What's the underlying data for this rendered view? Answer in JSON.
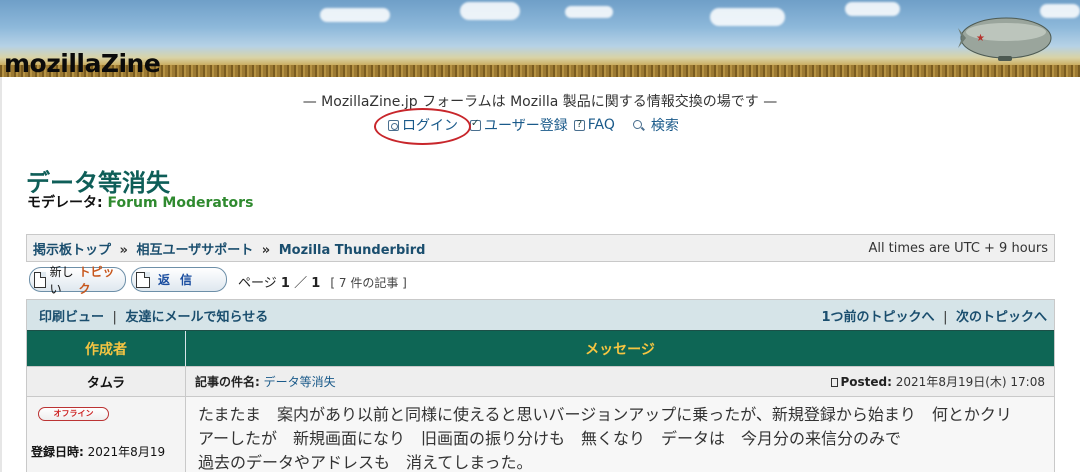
{
  "banner": {
    "logo": "mozillaZine",
    "icons": {
      "zeppelin": "zeppelin-icon"
    }
  },
  "site": {
    "description": "— MozillaZine.jp フォーラムは Mozilla 製品に関する情報交換の場です —",
    "nav": {
      "login": "ログイン",
      "register": "ユーザー登録",
      "faq": "FAQ",
      "search": "検索"
    },
    "highlight_color": "#c8262b"
  },
  "forum": {
    "title": "データ等消失",
    "moderators_label": "モデレータ:",
    "moderators_value": "Forum Moderators"
  },
  "breadcrumb": {
    "items": [
      "掲示板トップ",
      "相互ユーザサポート",
      "Mozilla Thunderbird"
    ],
    "separator": "»",
    "timezone": "All times are UTC + 9 hours"
  },
  "actions": {
    "new_topic_prefix": "新しい",
    "new_topic_accent": "トピック",
    "reply": "返信"
  },
  "paging": {
    "text_prefix": "ページ",
    "current": "1",
    "separator": "／",
    "total": "1",
    "count": "[ 7 件の記事 ]"
  },
  "topic_tools": {
    "print_view": "印刷ビュー",
    "email_friend": "友達にメールで知らせる",
    "prev_topic": "1つ前のトピックへ",
    "next_topic": "次のトピックへ",
    "separator": "|"
  },
  "table_headers": {
    "author": "作成者",
    "message": "メッセージ"
  },
  "post": {
    "author": "タムラ",
    "subject_label": "記事の件名:",
    "subject": "データ等消失",
    "posted_label": "Posted:",
    "posted_at": "2021年8月19日(木) 17:08",
    "status": "オフライン",
    "joined_label": "登録日時:",
    "joined": "2021年8月19",
    "body_lines": [
      "たまたま　案内があり以前と同様に使えると思いバージョンアップに乗ったが、新規登録から始まり　何とかクリ",
      "アーしたが　新規画面になり　旧画面の振り分けも　無くなり　データは　今月分の来信分のみで",
      "過去のデータやアドレスも　消えてしまった。"
    ]
  },
  "colors": {
    "header_bg": "#0e6655",
    "header_text": "#f5c542",
    "title": "#0e5e58",
    "moderator": "#2f8a2f",
    "link": "#1a5a8a"
  }
}
